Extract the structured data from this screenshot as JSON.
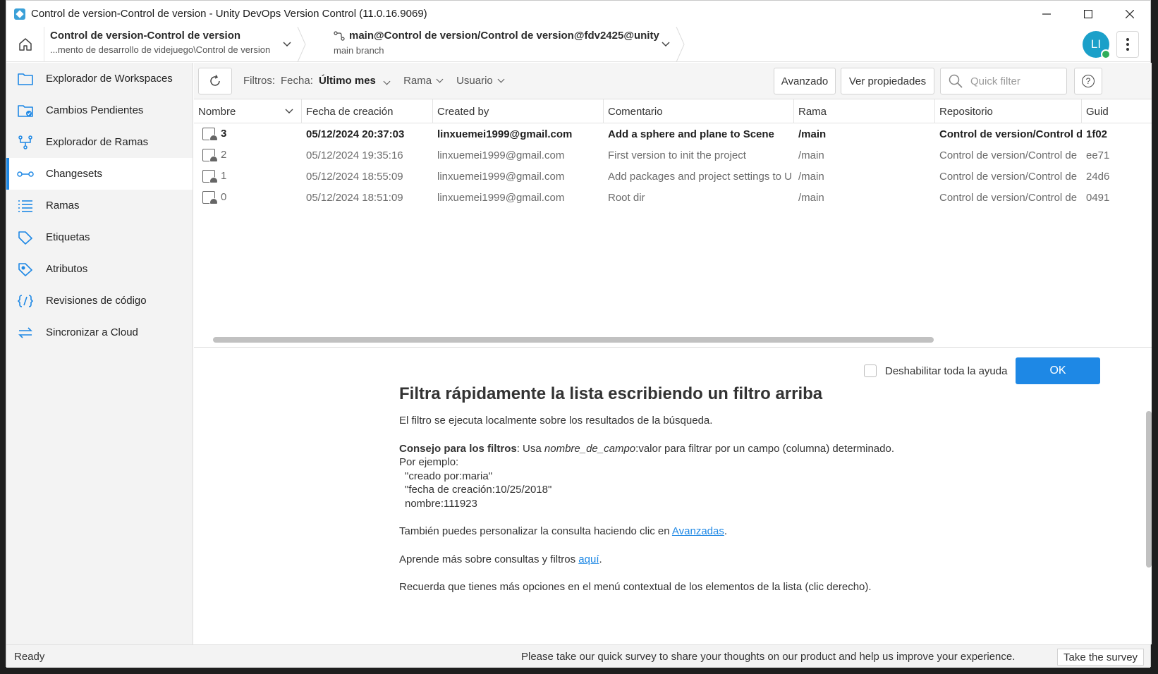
{
  "window": {
    "title": "Control de version-Control de version - Unity DevOps Version Control (11.0.16.9069)"
  },
  "header": {
    "workspace_title": "Control de version-Control de version",
    "workspace_path": "...mento de desarrollo de videjuego\\Control de version",
    "branch_title": "main@Control de version/Control de version@fdv2425@unity",
    "branch_sub": "main branch",
    "avatar_initials": "LI"
  },
  "sidebar": {
    "items": [
      {
        "label": "Explorador de Workspaces",
        "icon": "folder-icon"
      },
      {
        "label": "Cambios Pendientes",
        "icon": "pending-changes-icon"
      },
      {
        "label": "Explorador de Ramas",
        "icon": "branch-explorer-icon"
      },
      {
        "label": "Changesets",
        "icon": "changeset-icon",
        "active": true
      },
      {
        "label": "Ramas",
        "icon": "list-icon"
      },
      {
        "label": "Etiquetas",
        "icon": "tag-icon"
      },
      {
        "label": "Atributos",
        "icon": "attribute-tag-icon"
      },
      {
        "label": "Revisiones de código",
        "icon": "code-review-icon"
      },
      {
        "label": "Sincronizar a Cloud",
        "icon": "sync-icon"
      }
    ]
  },
  "toolbar": {
    "filters_label": "Filtros:",
    "date_label": "Fecha:",
    "date_value": "Último mes",
    "branch_filter": "Rama",
    "user_filter": "Usuario",
    "advanced_label": "Avanzado",
    "properties_label": "Ver propiedades",
    "quick_filter_placeholder": "Quick filter"
  },
  "table": {
    "columns": [
      "Nombre",
      "Fecha de creación",
      "Created by",
      "Comentario",
      "Rama",
      "Repositorio",
      "Guid"
    ],
    "rows": [
      {
        "name": "3",
        "date": "05/12/2024 20:37:03",
        "created_by": "linxuemei1999@gmail.com",
        "comment": "Add a sphere and plane to Scene",
        "branch": "/main",
        "repo": "Control de version/Control de",
        "guid": "1f02",
        "bold": true
      },
      {
        "name": "2",
        "date": "05/12/2024 19:35:16",
        "created_by": "linxuemei1999@gmail.com",
        "comment": "First version to init the project",
        "branch": "/main",
        "repo": "Control de version/Control de",
        "guid": "ee71"
      },
      {
        "name": "1",
        "date": "05/12/2024 18:55:09",
        "created_by": "linxuemei1999@gmail.com",
        "comment": "Add packages and project settings to U",
        "branch": "/main",
        "repo": "Control de version/Control de",
        "guid": "24d6"
      },
      {
        "name": "0",
        "date": "05/12/2024 18:51:09",
        "created_by": "linxuemei1999@gmail.com",
        "comment": "Root dir",
        "branch": "/main",
        "repo": "Control de version/Control de",
        "guid": "0491"
      }
    ]
  },
  "help": {
    "disable_label": "Deshabilitar toda la ayuda",
    "ok_label": "OK",
    "title": "Filtra rápidamente la lista escribiendo un filtro arriba",
    "p1": "El filtro se ejecuta localmente sobre los resultados de la búsqueda.",
    "tip_label": "Consejo para los filtros",
    "tip_pre": ": Usa ",
    "tip_field": "nombre_de_campo",
    "tip_post": ":valor para filtrar por un campo (columna) determinado.",
    "example_label": "Por ejemplo:",
    "ex1": "\"creado por:maria\"",
    "ex2": "\"fecha de creación:10/25/2018\"",
    "ex3": "nombre:111923",
    "p3_pre": "También puedes personalizar la consulta haciendo clic en ",
    "p3_link": "Avanzadas",
    "p3_post": ".",
    "p4_pre": "Aprende más sobre consultas y filtros ",
    "p4_link": "aquí",
    "p4_post": ".",
    "p5": "Recuerda que tienes más opciones en el menú contextual de los elementos de la lista (clic derecho)."
  },
  "status": {
    "ready": "Ready",
    "survey_text": "Please take our quick survey to share your thoughts on our product and help us improve your experience.",
    "survey_button": "Take the survey"
  },
  "colors": {
    "accent": "#1e88e5",
    "avatar": "#1ba0c9"
  }
}
